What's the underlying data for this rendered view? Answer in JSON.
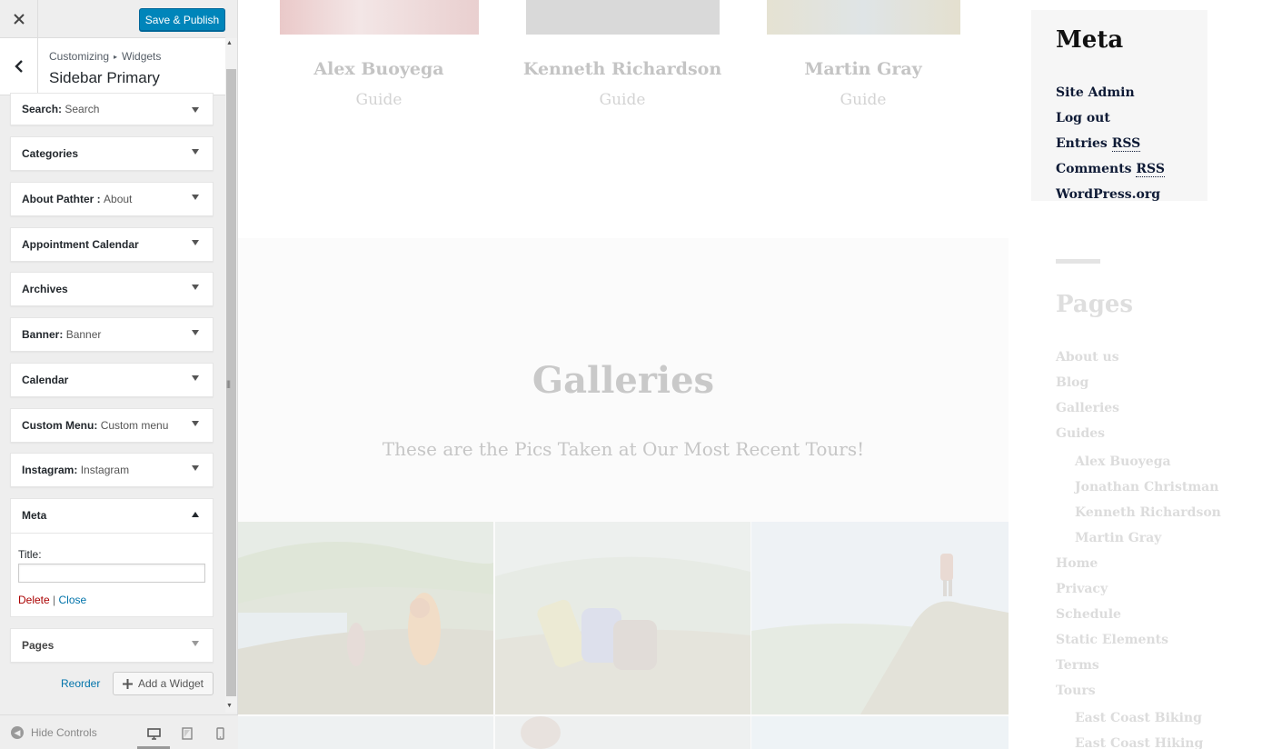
{
  "customizer": {
    "save_label": "Save & Publish",
    "breadcrumb": [
      "Customizing",
      "Widgets"
    ],
    "panel_title": "Sidebar Primary",
    "widgets": [
      {
        "title": "Search",
        "sub": "Search"
      },
      {
        "title": "Categories",
        "sub": ""
      },
      {
        "title": "About Pathter :",
        "sub": "About"
      },
      {
        "title": "Appointment Calendar",
        "sub": ""
      },
      {
        "title": "Archives",
        "sub": ""
      },
      {
        "title": "Banner",
        "sub": "Banner"
      },
      {
        "title": "Calendar",
        "sub": ""
      },
      {
        "title": "Custom Menu",
        "sub": "Custom menu"
      },
      {
        "title": "Instagram",
        "sub": "Instagram"
      }
    ],
    "meta_widget": {
      "title": "Meta",
      "field_label": "Title:",
      "field_value": "",
      "delete_label": "Delete",
      "separator": "|",
      "close_label": "Close"
    },
    "pages_widget": {
      "title": "Pages"
    },
    "reorder_label": "Reorder",
    "add_widget_label": "Add a Widget",
    "hide_controls_label": "Hide Controls"
  },
  "preview": {
    "guides": [
      {
        "name": "Alex Buoyega",
        "role": "Guide"
      },
      {
        "name": "Kenneth Richardson",
        "role": "Guide"
      },
      {
        "name": "Martin Gray",
        "role": "Guide"
      }
    ],
    "galleries_title": "Galleries",
    "galleries_subtitle": "These are the Pics Taken at Our Most Recent Tours!",
    "meta_widget": {
      "title": "Meta",
      "links": [
        {
          "text": "Site Admin",
          "abbr": ""
        },
        {
          "text": "Log out",
          "abbr": ""
        },
        {
          "text": "Entries",
          "abbr": "RSS"
        },
        {
          "text": "Comments",
          "abbr": "RSS"
        },
        {
          "text": "WordPress.org",
          "abbr": ""
        }
      ]
    },
    "pages_widget": {
      "title": "Pages",
      "items": [
        {
          "label": "About us",
          "level": 0
        },
        {
          "label": "Blog",
          "level": 0
        },
        {
          "label": "Galleries",
          "level": 0
        },
        {
          "label": "Guides",
          "level": 0
        },
        {
          "label": "Alex Buoyega",
          "level": 1
        },
        {
          "label": "Jonathan Christman",
          "level": 1
        },
        {
          "label": "Kenneth Richardson",
          "level": 1
        },
        {
          "label": "Martin Gray",
          "level": 1
        },
        {
          "label": "Home",
          "level": 0
        },
        {
          "label": "Privacy",
          "level": 0
        },
        {
          "label": "Schedule",
          "level": 0
        },
        {
          "label": "Static Elements",
          "level": 0
        },
        {
          "label": "Terms",
          "level": 0
        },
        {
          "label": "Tours",
          "level": 0
        },
        {
          "label": "East Coast Biking",
          "level": 1
        },
        {
          "label": "East Coast Hiking",
          "level": 1
        }
      ]
    }
  },
  "colors": {
    "primary_button": "#0085ba",
    "link": "#0073aa",
    "delete": "#aa0000",
    "sidebar_bg": "#eeeeee"
  }
}
